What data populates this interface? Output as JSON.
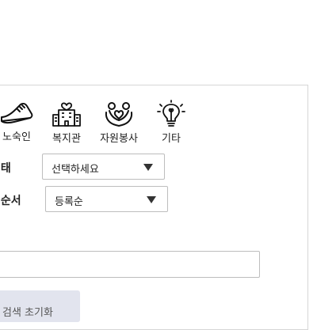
{
  "categories": [
    {
      "label": "노숙인",
      "icon": "shoe-icon"
    },
    {
      "label": "복지관",
      "icon": "building-heart-icon"
    },
    {
      "label": "자원봉사",
      "icon": "volunteer-hands-icon"
    },
    {
      "label": "기타",
      "icon": "lightbulb-icon"
    }
  ],
  "filters": {
    "type_label": "형태",
    "type_selected": "선택하세요",
    "order_label": "열순서",
    "order_selected": "등록순"
  },
  "search": {
    "value": ""
  },
  "reset_button_label": "검색 초기화"
}
